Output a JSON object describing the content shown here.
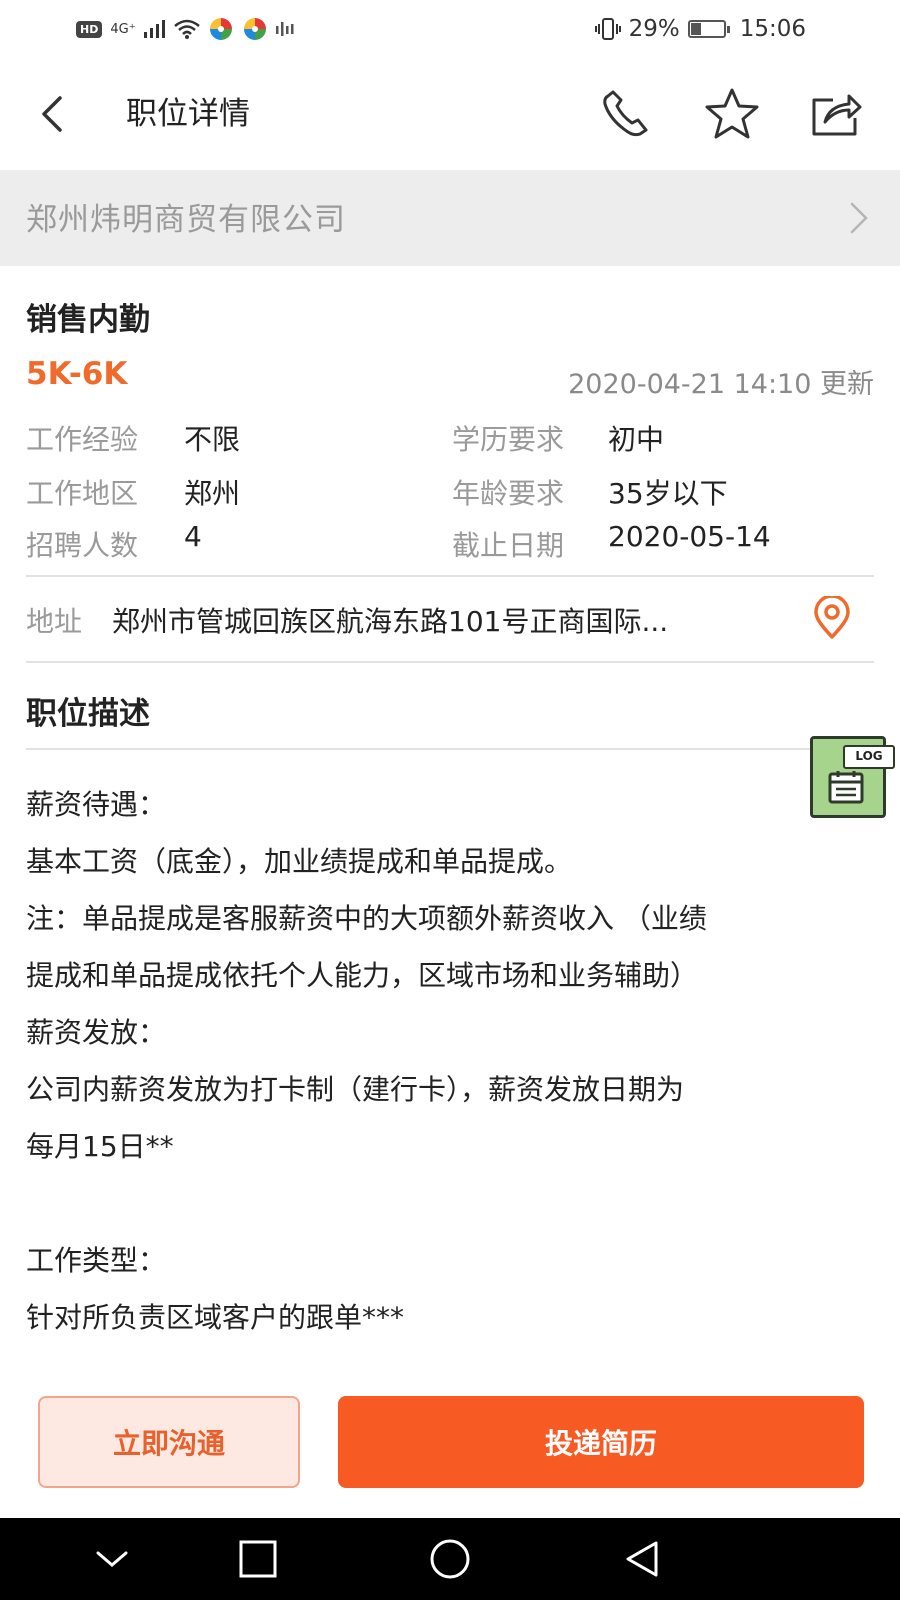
{
  "status_bar": {
    "hd": "HD",
    "network": "4G⁺",
    "battery": "29%",
    "time": "15:06"
  },
  "header": {
    "title": "职位详情",
    "icons": [
      "back-icon",
      "phone-icon",
      "star-icon",
      "share-icon"
    ]
  },
  "company": {
    "name": "郑州炜明商贸有限公司"
  },
  "job": {
    "title": "销售内勤",
    "salary": "5K-6K",
    "updated": "2020-04-21 14:10  更新",
    "fields": [
      {
        "label": "工作经验",
        "value": "不限"
      },
      {
        "label": "学历要求",
        "value": "初中"
      },
      {
        "label": "工作地区",
        "value": "郑州"
      },
      {
        "label": "年龄要求",
        "value": "35岁以下"
      },
      {
        "label": "招聘人数",
        "value": "4"
      },
      {
        "label": "截止日期",
        "value": "2020-05-14"
      }
    ],
    "address_label": "地址",
    "address": "郑州市管城回族区航海东路101号正商国际..."
  },
  "description": {
    "title": "职位描述",
    "lines": [
      "薪资待遇：",
      "基本工资（底金），加业绩提成和单品提成。",
      "注：单品提成是客服薪资中的大项额外薪资收入 （业绩",
      "提成和单品提成依托个人能力，区域市场和业务辅助）",
      "薪资发放：",
      "公司内薪资发放为打卡制（建行卡），薪资发放日期为",
      "每月15日**",
      "",
      "工作类型：",
      "针对所负责区域客户的跟单***"
    ]
  },
  "log_widget": {
    "label": "LOG"
  },
  "actions": {
    "chat": "立即沟通",
    "apply": "投递简历"
  },
  "colors": {
    "accent": "#f75a22",
    "salary": "#f06a2b",
    "muted": "#9a9a9a"
  }
}
